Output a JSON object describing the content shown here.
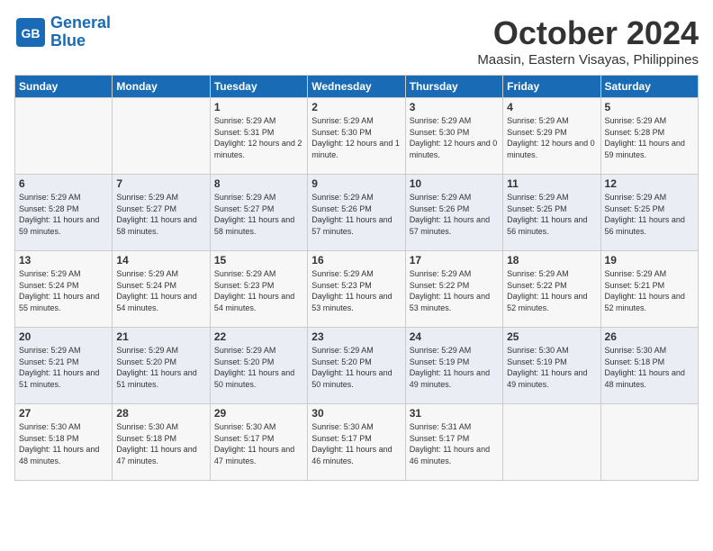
{
  "header": {
    "logo_line1": "General",
    "logo_line2": "Blue",
    "month": "October 2024",
    "location": "Maasin, Eastern Visayas, Philippines"
  },
  "days_of_week": [
    "Sunday",
    "Monday",
    "Tuesday",
    "Wednesday",
    "Thursday",
    "Friday",
    "Saturday"
  ],
  "weeks": [
    [
      {
        "day": "",
        "sunrise": "",
        "sunset": "",
        "daylight": ""
      },
      {
        "day": "",
        "sunrise": "",
        "sunset": "",
        "daylight": ""
      },
      {
        "day": "1",
        "sunrise": "Sunrise: 5:29 AM",
        "sunset": "Sunset: 5:31 PM",
        "daylight": "Daylight: 12 hours and 2 minutes."
      },
      {
        "day": "2",
        "sunrise": "Sunrise: 5:29 AM",
        "sunset": "Sunset: 5:30 PM",
        "daylight": "Daylight: 12 hours and 1 minute."
      },
      {
        "day": "3",
        "sunrise": "Sunrise: 5:29 AM",
        "sunset": "Sunset: 5:30 PM",
        "daylight": "Daylight: 12 hours and 0 minutes."
      },
      {
        "day": "4",
        "sunrise": "Sunrise: 5:29 AM",
        "sunset": "Sunset: 5:29 PM",
        "daylight": "Daylight: 12 hours and 0 minutes."
      },
      {
        "day": "5",
        "sunrise": "Sunrise: 5:29 AM",
        "sunset": "Sunset: 5:28 PM",
        "daylight": "Daylight: 11 hours and 59 minutes."
      }
    ],
    [
      {
        "day": "6",
        "sunrise": "Sunrise: 5:29 AM",
        "sunset": "Sunset: 5:28 PM",
        "daylight": "Daylight: 11 hours and 59 minutes."
      },
      {
        "day": "7",
        "sunrise": "Sunrise: 5:29 AM",
        "sunset": "Sunset: 5:27 PM",
        "daylight": "Daylight: 11 hours and 58 minutes."
      },
      {
        "day": "8",
        "sunrise": "Sunrise: 5:29 AM",
        "sunset": "Sunset: 5:27 PM",
        "daylight": "Daylight: 11 hours and 58 minutes."
      },
      {
        "day": "9",
        "sunrise": "Sunrise: 5:29 AM",
        "sunset": "Sunset: 5:26 PM",
        "daylight": "Daylight: 11 hours and 57 minutes."
      },
      {
        "day": "10",
        "sunrise": "Sunrise: 5:29 AM",
        "sunset": "Sunset: 5:26 PM",
        "daylight": "Daylight: 11 hours and 57 minutes."
      },
      {
        "day": "11",
        "sunrise": "Sunrise: 5:29 AM",
        "sunset": "Sunset: 5:25 PM",
        "daylight": "Daylight: 11 hours and 56 minutes."
      },
      {
        "day": "12",
        "sunrise": "Sunrise: 5:29 AM",
        "sunset": "Sunset: 5:25 PM",
        "daylight": "Daylight: 11 hours and 56 minutes."
      }
    ],
    [
      {
        "day": "13",
        "sunrise": "Sunrise: 5:29 AM",
        "sunset": "Sunset: 5:24 PM",
        "daylight": "Daylight: 11 hours and 55 minutes."
      },
      {
        "day": "14",
        "sunrise": "Sunrise: 5:29 AM",
        "sunset": "Sunset: 5:24 PM",
        "daylight": "Daylight: 11 hours and 54 minutes."
      },
      {
        "day": "15",
        "sunrise": "Sunrise: 5:29 AM",
        "sunset": "Sunset: 5:23 PM",
        "daylight": "Daylight: 11 hours and 54 minutes."
      },
      {
        "day": "16",
        "sunrise": "Sunrise: 5:29 AM",
        "sunset": "Sunset: 5:23 PM",
        "daylight": "Daylight: 11 hours and 53 minutes."
      },
      {
        "day": "17",
        "sunrise": "Sunrise: 5:29 AM",
        "sunset": "Sunset: 5:22 PM",
        "daylight": "Daylight: 11 hours and 53 minutes."
      },
      {
        "day": "18",
        "sunrise": "Sunrise: 5:29 AM",
        "sunset": "Sunset: 5:22 PM",
        "daylight": "Daylight: 11 hours and 52 minutes."
      },
      {
        "day": "19",
        "sunrise": "Sunrise: 5:29 AM",
        "sunset": "Sunset: 5:21 PM",
        "daylight": "Daylight: 11 hours and 52 minutes."
      }
    ],
    [
      {
        "day": "20",
        "sunrise": "Sunrise: 5:29 AM",
        "sunset": "Sunset: 5:21 PM",
        "daylight": "Daylight: 11 hours and 51 minutes."
      },
      {
        "day": "21",
        "sunrise": "Sunrise: 5:29 AM",
        "sunset": "Sunset: 5:20 PM",
        "daylight": "Daylight: 11 hours and 51 minutes."
      },
      {
        "day": "22",
        "sunrise": "Sunrise: 5:29 AM",
        "sunset": "Sunset: 5:20 PM",
        "daylight": "Daylight: 11 hours and 50 minutes."
      },
      {
        "day": "23",
        "sunrise": "Sunrise: 5:29 AM",
        "sunset": "Sunset: 5:20 PM",
        "daylight": "Daylight: 11 hours and 50 minutes."
      },
      {
        "day": "24",
        "sunrise": "Sunrise: 5:29 AM",
        "sunset": "Sunset: 5:19 PM",
        "daylight": "Daylight: 11 hours and 49 minutes."
      },
      {
        "day": "25",
        "sunrise": "Sunrise: 5:30 AM",
        "sunset": "Sunset: 5:19 PM",
        "daylight": "Daylight: 11 hours and 49 minutes."
      },
      {
        "day": "26",
        "sunrise": "Sunrise: 5:30 AM",
        "sunset": "Sunset: 5:18 PM",
        "daylight": "Daylight: 11 hours and 48 minutes."
      }
    ],
    [
      {
        "day": "27",
        "sunrise": "Sunrise: 5:30 AM",
        "sunset": "Sunset: 5:18 PM",
        "daylight": "Daylight: 11 hours and 48 minutes."
      },
      {
        "day": "28",
        "sunrise": "Sunrise: 5:30 AM",
        "sunset": "Sunset: 5:18 PM",
        "daylight": "Daylight: 11 hours and 47 minutes."
      },
      {
        "day": "29",
        "sunrise": "Sunrise: 5:30 AM",
        "sunset": "Sunset: 5:17 PM",
        "daylight": "Daylight: 11 hours and 47 minutes."
      },
      {
        "day": "30",
        "sunrise": "Sunrise: 5:30 AM",
        "sunset": "Sunset: 5:17 PM",
        "daylight": "Daylight: 11 hours and 46 minutes."
      },
      {
        "day": "31",
        "sunrise": "Sunrise: 5:31 AM",
        "sunset": "Sunset: 5:17 PM",
        "daylight": "Daylight: 11 hours and 46 minutes."
      },
      {
        "day": "",
        "sunrise": "",
        "sunset": "",
        "daylight": ""
      },
      {
        "day": "",
        "sunrise": "",
        "sunset": "",
        "daylight": ""
      }
    ]
  ]
}
